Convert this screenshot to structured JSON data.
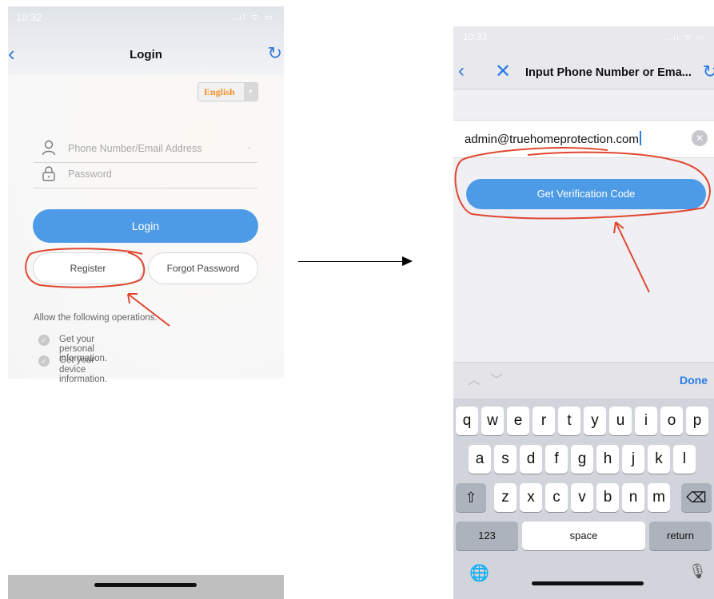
{
  "left_screen": {
    "status": {
      "time": "10:32",
      "icons": "..ıl ᯤ ▭"
    },
    "nav": {
      "title": "Login",
      "back_glyph": "‹",
      "refresh_glyph": "↻"
    },
    "language": {
      "selected": "English",
      "caret": "▾"
    },
    "phone_field": {
      "placeholder": "Phone Number/Email Address",
      "dot": "·"
    },
    "password_field": {
      "placeholder": "Password"
    },
    "login_button": "Login",
    "register_button": "Register",
    "forgot_button": "Forgot Password",
    "permissions": {
      "title": "Allow the following operations:",
      "items": [
        "Get your personal information.",
        "Get your device information."
      ]
    }
  },
  "right_screen": {
    "status": {
      "time": "10:33",
      "icons": "..ıl ᯤ ▭"
    },
    "nav": {
      "title": "Input Phone Number or Ema...",
      "back_glyph": "‹",
      "close_glyph": "✕",
      "refresh_glyph": "↻"
    },
    "email_value": "admin@truehomeprotection.com",
    "clear_glyph": "✕",
    "verify_button": "Get Verification Code",
    "toolbar": {
      "up": "︿",
      "down": "﹀",
      "done": "Done"
    },
    "keyboard": {
      "row1": [
        "q",
        "w",
        "e",
        "r",
        "t",
        "y",
        "u",
        "i",
        "o",
        "p"
      ],
      "row2": [
        "a",
        "s",
        "d",
        "f",
        "g",
        "h",
        "j",
        "k",
        "l"
      ],
      "row3": [
        "z",
        "x",
        "c",
        "v",
        "b",
        "n",
        "m"
      ],
      "shift": "⇧",
      "delete": "⌫",
      "numbers": "123",
      "space": "space",
      "return": "return",
      "globe": "🌐",
      "mic": "🎙"
    }
  },
  "colors": {
    "accent_blue": "#4d9be6",
    "ios_blue": "#2a7ce6",
    "annotation_red": "#e0472f",
    "language_orange": "#f0932e"
  }
}
